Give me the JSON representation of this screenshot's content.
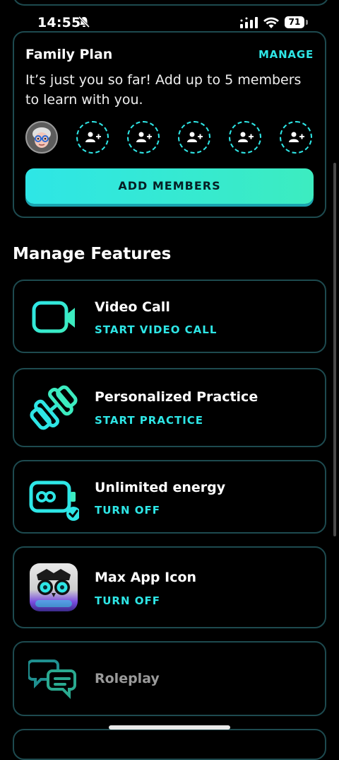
{
  "status_bar": {
    "time": "14:55",
    "battery": "71"
  },
  "family_plan": {
    "title": "Family Plan",
    "manage_label": "MANAGE",
    "description": "It’s just you so far! Add up to 5 members to learn with you.",
    "add_button_label": "ADD MEMBERS",
    "empty_slots": 5
  },
  "manage_features": {
    "title": "Manage Features",
    "items": [
      {
        "name": "Video Call",
        "action": "START VIDEO CALL",
        "icon": "video-camera-icon"
      },
      {
        "name": "Personalized Practice",
        "action": "START PRACTICE",
        "icon": "dumbbell-icon"
      },
      {
        "name": "Unlimited energy",
        "action": "TURN OFF",
        "icon": "infinity-battery-icon"
      },
      {
        "name": "Max App Icon",
        "action": "TURN OFF",
        "icon": "owl-app-icon"
      },
      {
        "name": "Roleplay",
        "action": "",
        "icon": "chat-bubbles-icon"
      }
    ]
  },
  "colors": {
    "accent": "#2ee6e6",
    "border": "#1d4a4f",
    "background": "#000000"
  }
}
